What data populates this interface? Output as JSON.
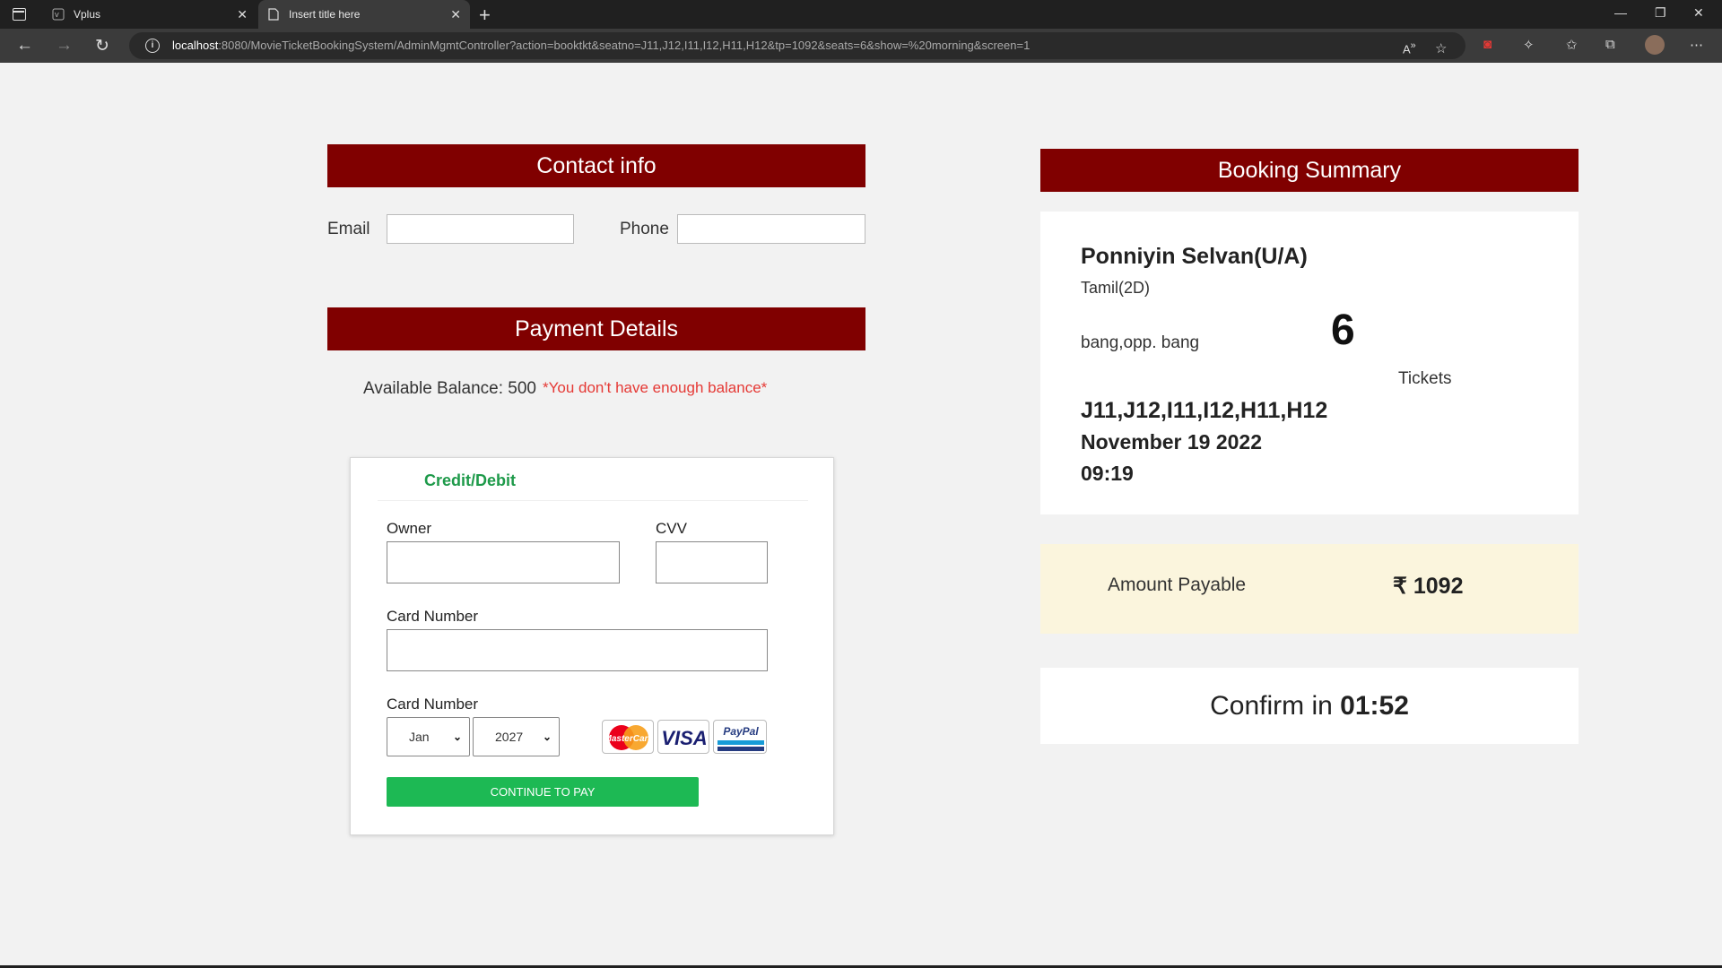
{
  "browser": {
    "tabs": [
      {
        "title": "Vplus",
        "favicon": "vplus-icon"
      },
      {
        "title": "Insert title here",
        "favicon": "page-icon"
      }
    ],
    "url_host": "localhost",
    "url_rest": ":8080/MovieTicketBookingSystem/AdminMgmtController?action=booktkt&seatno=J11,J12,I11,I12,H11,H12&tp=1092&seats=6&show=%20morning&screen=1"
  },
  "contact": {
    "header": "Contact info",
    "email_label": "Email",
    "email_value": "",
    "phone_label": "Phone",
    "phone_value": ""
  },
  "payment": {
    "header": "Payment Details",
    "balance_text": "Available Balance: 500",
    "warning": "*You don't have enough balance*",
    "method_title": "Credit/Debit",
    "owner_label": "Owner",
    "owner_value": "",
    "cvv_label": "CVV",
    "cvv_value": "",
    "card_number_label": "Card Number",
    "card_number_value": "",
    "expiry_label": "Card Number",
    "month_selected": "Jan",
    "year_selected": "2027",
    "card_logos": [
      "MasterCard",
      "VISA",
      "PayPal"
    ],
    "pay_button": "CONTINUE TO PAY"
  },
  "summary": {
    "header": "Booking Summary",
    "movie": "Ponniyin Selvan(U/A)",
    "language": "Tamil(2D)",
    "venue": "bang,opp. bang",
    "ticket_count": "6",
    "tickets_label": "Tickets",
    "seats": "J11,J12,I11,I12,H11,H12",
    "date": "November 19 2022",
    "time": "09:19",
    "amount_label": "Amount Payable",
    "amount_value": "₹ 1092",
    "confirm_prefix": "Confirm in ",
    "confirm_timer": "01:52"
  },
  "colors": {
    "header_bg": "#800000",
    "accent_green": "#1db954",
    "warning_red": "#e53935",
    "amount_panel_bg": "#fbf5dd"
  }
}
